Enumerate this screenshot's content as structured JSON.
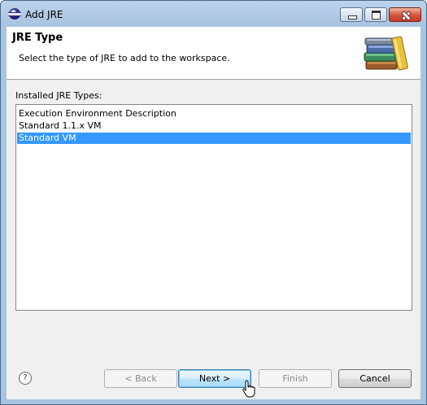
{
  "window": {
    "title": "Add JRE"
  },
  "header": {
    "title": "JRE Type",
    "description": "Select the type of JRE to add to the workspace.",
    "image_icon": "books-icon"
  },
  "installed": {
    "label": "Installed JRE Types:",
    "items": [
      {
        "label": "Execution Environment Description",
        "selected": false
      },
      {
        "label": "Standard 1.1.x VM",
        "selected": false
      },
      {
        "label": "Standard VM",
        "selected": true
      }
    ]
  },
  "buttons": {
    "help": "?",
    "back": "< Back",
    "next": "Next >",
    "finish": "Finish",
    "cancel": "Cancel"
  },
  "colors": {
    "selection": "#3399ff",
    "titlebar": "#a9c4e0",
    "close_button": "#d4533a"
  }
}
